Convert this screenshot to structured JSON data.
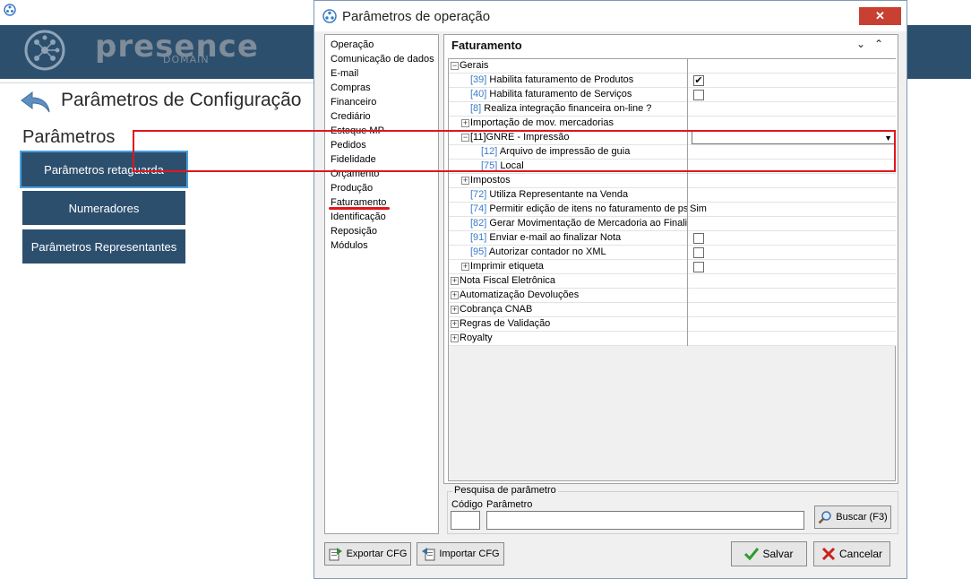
{
  "app": {
    "logo_text": "presence",
    "logo_sub": "DOMAIN",
    "page_title": "Parâmetros de Configuração",
    "section_title": "Parâmetros",
    "side_buttons": [
      "Parâmetros retaguarda",
      "Numeradores",
      "Parâmetros Representantes"
    ]
  },
  "dialog": {
    "title": "Parâmetros de operação",
    "close_label": "✕",
    "categories": [
      "Operação",
      "Comunicação de dados",
      "E-mail",
      "Compras",
      "Financeiro",
      "Crediário",
      "Estoque MP",
      "Pedidos",
      "Fidelidade",
      "Orçamento",
      "Produção",
      "Faturamento",
      "Identificação",
      "Reposição",
      "Módulos"
    ],
    "section_heading": "Faturamento",
    "head_arrows": "⌄⌃",
    "rows": [
      {
        "indent": 0,
        "expander": "−",
        "code": "",
        "label": "Gerais",
        "value": ""
      },
      {
        "indent": 1,
        "expander": "",
        "code": "[39]",
        "label": "Habilita faturamento de Produtos",
        "value": "checked"
      },
      {
        "indent": 1,
        "expander": "",
        "code": "[40]",
        "label": "Habilita faturamento de Serviços",
        "value": "unchecked"
      },
      {
        "indent": 1,
        "expander": "",
        "code": "[8]",
        "label": "Realiza integração financeira on-line ?",
        "value": ""
      },
      {
        "indent": 1,
        "expander": "+",
        "code": "",
        "label": "Importação de mov. mercadorias",
        "value": ""
      },
      {
        "indent": 1,
        "expander": "−",
        "code": "",
        "label": "[11]GNRE - Impressão",
        "value": "dropdown"
      },
      {
        "indent": 2,
        "expander": "",
        "code": "[12]",
        "label": "Arquivo de impressão de guia",
        "value": ""
      },
      {
        "indent": 2,
        "expander": "",
        "code": "[75]",
        "label": "Local",
        "value": ""
      },
      {
        "indent": 1,
        "expander": "+",
        "code": "",
        "label": "Impostos",
        "value": ""
      },
      {
        "indent": 1,
        "expander": "",
        "code": "[72]",
        "label": "Utiliza Representante na Venda",
        "value": ""
      },
      {
        "indent": 1,
        "expander": "",
        "code": "[74]",
        "label": "Permitir edição de itens no faturamento de ps",
        "value": "Sim"
      },
      {
        "indent": 1,
        "expander": "",
        "code": "[82]",
        "label": "Gerar Movimentação de Mercadoria ao Finalia",
        "value": ""
      },
      {
        "indent": 1,
        "expander": "",
        "code": "[91]",
        "label": "Enviar e-mail ao finalizar Nota",
        "value": "unchecked"
      },
      {
        "indent": 1,
        "expander": "",
        "code": "[95]",
        "label": "Autorizar contador no XML",
        "value": "unchecked"
      },
      {
        "indent": 1,
        "expander": "+",
        "code": "",
        "label": "Imprimir etiqueta",
        "value": "unchecked"
      },
      {
        "indent": 0,
        "expander": "+",
        "code": "",
        "label": "Nota Fiscal Eletrônica",
        "value": ""
      },
      {
        "indent": 0,
        "expander": "+",
        "code": "",
        "label": "Automatização Devoluções",
        "value": ""
      },
      {
        "indent": 0,
        "expander": "+",
        "code": "",
        "label": "Cobrança CNAB",
        "value": ""
      },
      {
        "indent": 0,
        "expander": "+",
        "code": "",
        "label": "Regras de Validação",
        "value": ""
      },
      {
        "indent": 0,
        "expander": "+",
        "code": "",
        "label": "Royalty",
        "value": ""
      }
    ],
    "search": {
      "legend": "Pesquisa de parâmetro",
      "code_label": "Código",
      "param_label": "Parâmetro",
      "code_value": "",
      "param_value": "",
      "button": "Buscar (F3)"
    },
    "footer": {
      "export": "Exportar CFG",
      "import": "Importar CFG",
      "save": "Salvar",
      "cancel": "Cancelar"
    }
  }
}
